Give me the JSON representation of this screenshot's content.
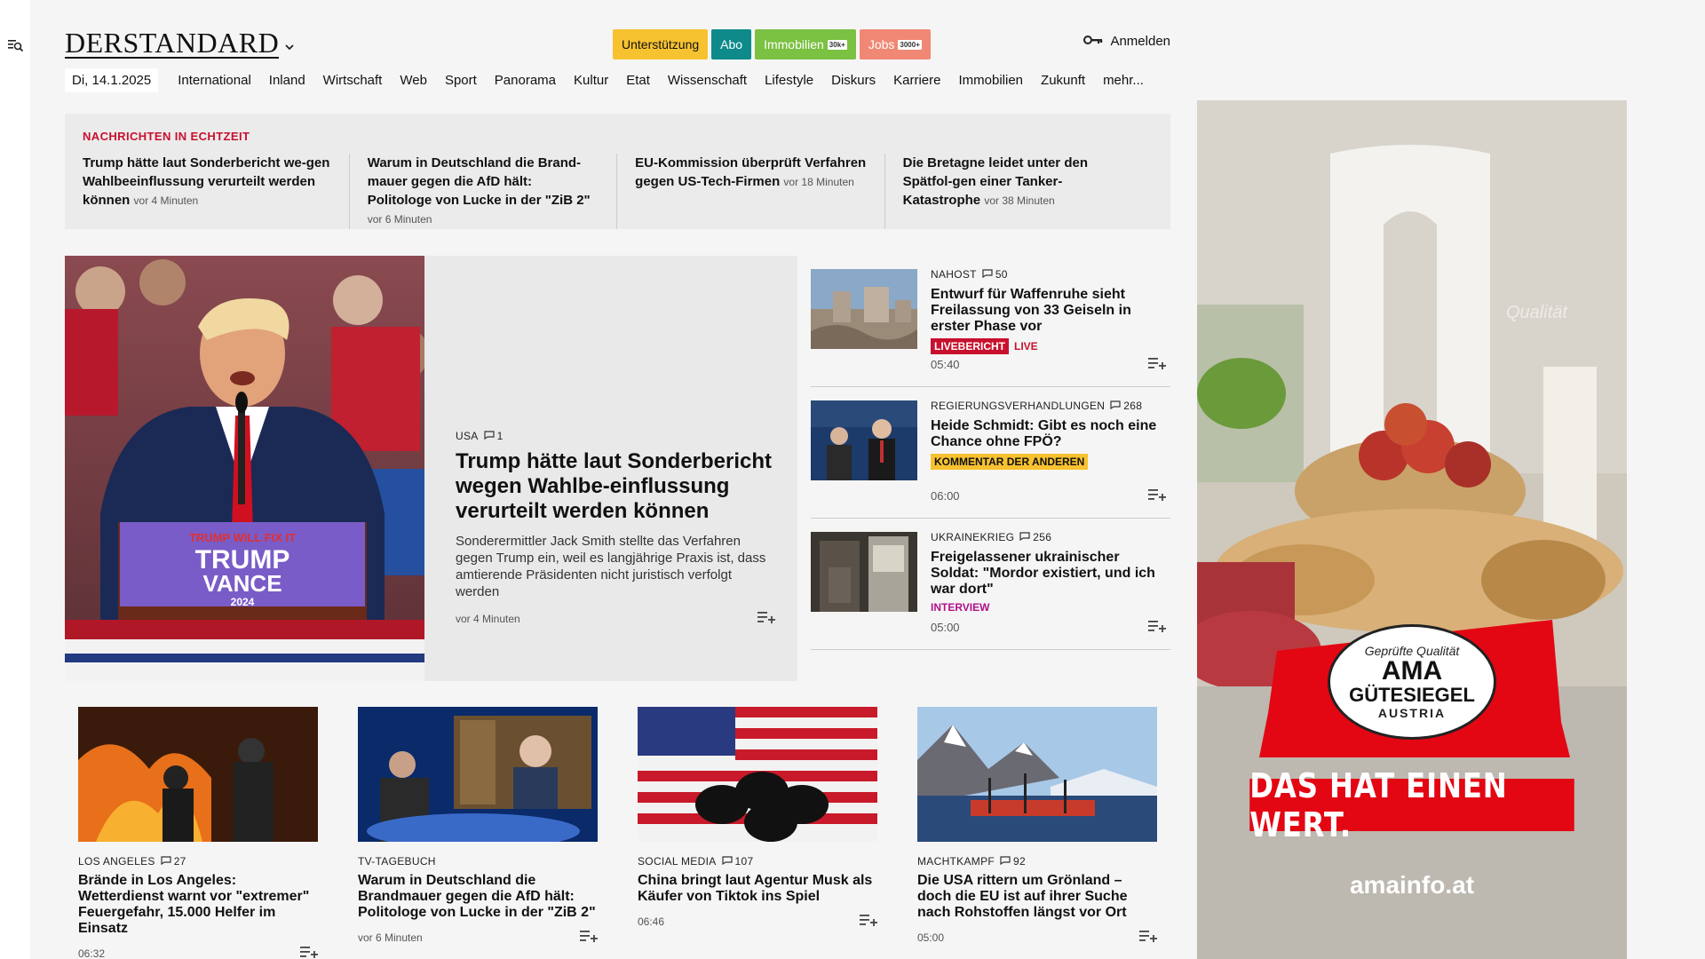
{
  "header": {
    "logo": "DERSTANDARD",
    "pills": [
      {
        "label": "Unterstützung",
        "tag": ""
      },
      {
        "label": "Abo",
        "tag": ""
      },
      {
        "label": "Immobilien",
        "tag": "30k+"
      },
      {
        "label": "Jobs",
        "tag": "3000+"
      }
    ],
    "login_label": "Anmelden"
  },
  "nav": {
    "date": "Di, 14.1.2025",
    "items": [
      "International",
      "Inland",
      "Wirtschaft",
      "Web",
      "Sport",
      "Panorama",
      "Kultur",
      "Etat",
      "Wissenschaft",
      "Lifestyle",
      "Diskurs",
      "Karriere",
      "Immobilien",
      "Zukunft",
      "mehr..."
    ]
  },
  "ticker": {
    "title": "NACHRICHTEN IN ECHTZEIT",
    "items": [
      {
        "text": "Trump hätte laut Sonderbericht we-gen Wahlbeeinflussung verurteilt werden können",
        "time": "vor 4 Minuten"
      },
      {
        "text": "Warum in Deutschland die Brand-mauer gegen die AfD hält: Politologe von Lucke in der \"ZiB 2\"",
        "time": "vor 6 Minuten"
      },
      {
        "text": "EU-Kommission überprüft Verfahren gegen US-Tech-Firmen",
        "time": "vor 18 Minuten"
      },
      {
        "text": "Die Bretagne leidet unter den Spätfol-gen einer Tanker-Katastrophe",
        "time": "vor 38 Minuten"
      }
    ]
  },
  "hero": {
    "kicker": "USA",
    "comments": "1",
    "title": "Trump hätte laut Sonderbericht wegen Wahlbe-einflussung verurteilt werden können",
    "lead": "Sonderermittler Jack Smith stellte das Verfahren gegen Trump ein, weil es langjährige Praxis ist, dass amtierende Präsidenten nicht juristisch verfolgt werden",
    "time": "vor 4 Minuten",
    "podium_line1": "TRUMP WILL FIX IT",
    "podium_line2": "TRUMP",
    "podium_line3": "VANCE",
    "podium_line4": "2024"
  },
  "side": [
    {
      "kicker": "NAHOST",
      "comments": "50",
      "title": "Entwurf für Waffenruhe sieht Freilassung von 33 Geiseln in erster Phase vor",
      "badge": "LIVEBERICHT",
      "extra": "LIVE",
      "time": "05:40"
    },
    {
      "kicker": "REGIERUNGSVERHANDLUNGEN",
      "comments": "268",
      "title": "Heide Schmidt: Gibt es noch eine Chance ohne FPÖ?",
      "badge": "KOMMENTAR DER ANDEREN",
      "extra": "",
      "time": "06:00"
    },
    {
      "kicker": "UKRAINEKRIEG",
      "comments": "256",
      "title": "Freigelassener ukrainischer Soldat: \"Mordor existiert, und ich war dort\"",
      "badge": "INTERVIEW",
      "extra": "",
      "time": "05:00"
    }
  ],
  "cards": [
    {
      "kicker": "LOS ANGELES",
      "comments": "27",
      "title": "Brände in Los Angeles: Wetterdienst warnt vor \"extremer\" Feuergefahr, 15.000 Helfer im Einsatz",
      "time": "06:32"
    },
    {
      "kicker": "TV-TAGEBUCH",
      "comments": "",
      "title": "Warum in Deutschland die Brandmauer gegen die AfD hält: Politologe von Lucke in der \"ZiB 2\"",
      "time": "vor 6 Minuten"
    },
    {
      "kicker": "SOCIAL MEDIA",
      "comments": "107",
      "title": "China bringt laut Agentur Musk als Käufer von Tiktok ins Spiel",
      "time": "06:46"
    },
    {
      "kicker": "MACHTKAMPF",
      "comments": "92",
      "title": "Die USA rittern um Grönland – doch die EU ist auf ihrer Suche nach Rohstoffen längst vor Ort",
      "time": "05:00"
    }
  ],
  "ad": {
    "seal_top": "Geprüfte Qualität",
    "seal_main": "AMA",
    "seal_sub": "GÜTESIEGEL",
    "seal_bottom": "AUSTRIA",
    "slogan": "DAS HAT EINEN WERT.",
    "url": "amainfo.at",
    "faint": "Qualität"
  },
  "colors": {
    "red": "#c8102e",
    "yellow": "#f7c230",
    "teal": "#0e8a8a",
    "green": "#7bc142",
    "salmon": "#f08875"
  }
}
